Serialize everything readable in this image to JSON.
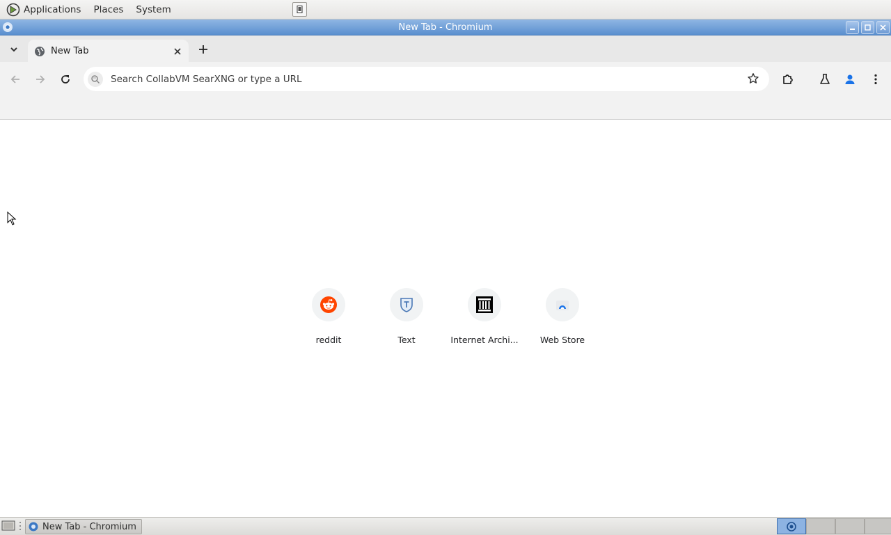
{
  "top_panel": {
    "menus": [
      "Applications",
      "Places",
      "System"
    ]
  },
  "window": {
    "title": "New Tab - Chromium"
  },
  "tabs": [
    {
      "title": "New Tab",
      "favicon": "globe-icon"
    }
  ],
  "toolbar": {
    "omnibox_placeholder": "Search CollabVM SearXNG or type a URL",
    "omnibox_value": ""
  },
  "shortcuts": [
    {
      "label": "reddit",
      "icon": "reddit-icon"
    },
    {
      "label": "Text",
      "icon": "text-shield-icon"
    },
    {
      "label": "Internet Archi...",
      "icon": "archive-building-icon"
    },
    {
      "label": "Web Store",
      "icon": "webstore-icon"
    }
  ],
  "taskbar": {
    "task_label": "New Tab - Chromium"
  },
  "colors": {
    "titlebar": "#5a8fcf",
    "toolbar": "#f2f2f2",
    "tabstrip": "#e8e8e8",
    "reddit": "#ff4500",
    "profile": "#1a73e8"
  }
}
